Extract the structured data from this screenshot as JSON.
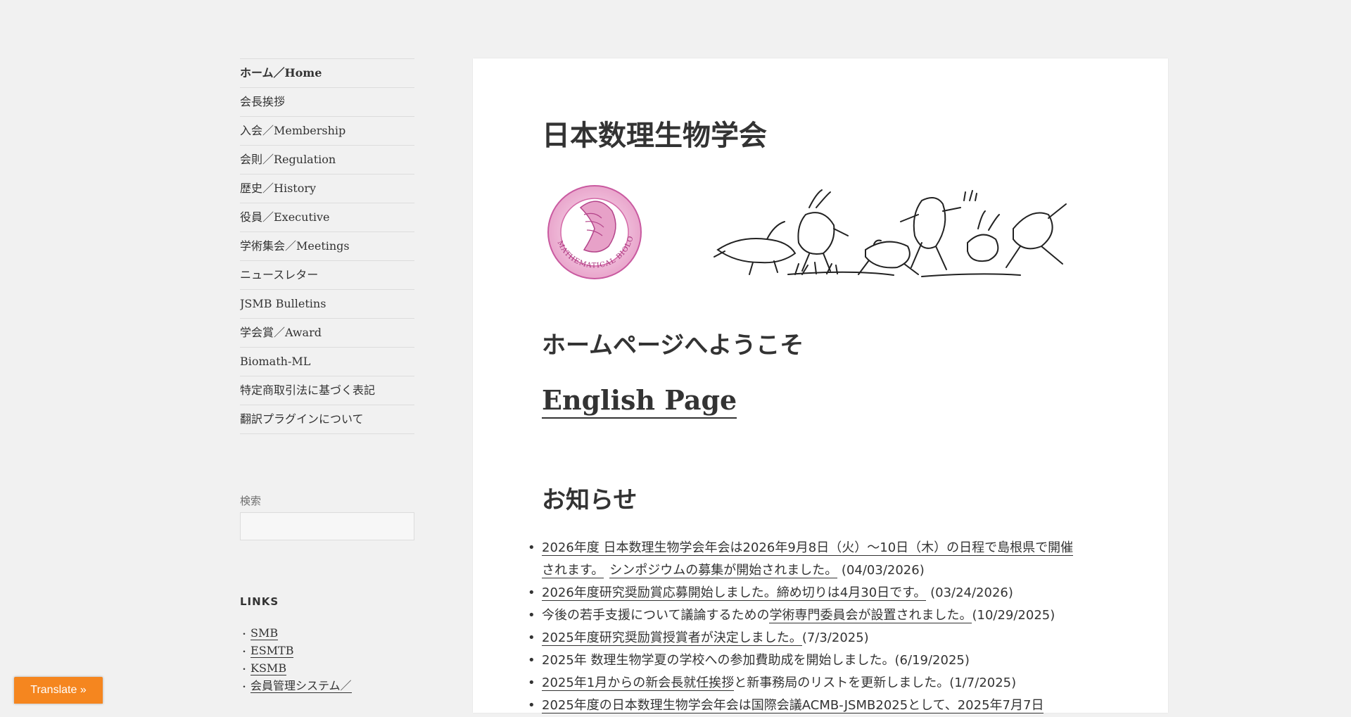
{
  "sidebar": {
    "nav": [
      {
        "label": "ホーム／Home"
      },
      {
        "label": "会長挨拶"
      },
      {
        "label": "入会／Membership"
      },
      {
        "label": "会則／Regulation"
      },
      {
        "label": "歴史／History"
      },
      {
        "label": "役員／Executive"
      },
      {
        "label": "学術集会／Meetings"
      },
      {
        "label": "ニュースレター"
      },
      {
        "label": "JSMB Bulletins"
      },
      {
        "label": "学会賞／Award"
      },
      {
        "label": "Biomath-ML"
      },
      {
        "label": "特定商取引法に基づく表記"
      },
      {
        "label": "翻訳プラグインについて"
      }
    ],
    "search": {
      "label": "検索",
      "value": "",
      "placeholder": ""
    },
    "links": {
      "title": "LINKS",
      "items": [
        {
          "label": "SMB"
        },
        {
          "label": "ESMTB"
        },
        {
          "label": "KSMB"
        },
        {
          "label": "会員管理システム／"
        }
      ]
    }
  },
  "main": {
    "site_title": "日本数理生物学会",
    "logo_text": "MATHEMATICAL BIOLOGY",
    "welcome": "ホームページへようこそ",
    "english_link": "English Page",
    "news_heading": "お知らせ",
    "news": [
      {
        "link": "2026年度 日本数理生物学会年会は2026年9月8日（火）〜10日（木）の日程で島根県で開催",
        "link2": "されます。",
        "mid": "",
        "link3": "シンポジウムの募集が開始されました。",
        "date": " (04/03/2026)"
      },
      {
        "link": "2026年度研究奨励賞応募開始しました。締め切りは4月30日です。",
        "date": " (03/24/2026)"
      },
      {
        "pre": "今後の若手支援について議論するための",
        "link": "学術専門委員会が設置されました。",
        "date": "(10/29/2025)"
      },
      {
        "link": "2025年度研究奨励賞授賞者が決定しました。",
        "date": "(7/3/2025)"
      },
      {
        "pre": "2025年 数理生物学夏の学校への参加費助成を開始しました。(6/19/2025)"
      },
      {
        "link": "2025年1月からの新会長就任挨拶",
        "mid": "と新事務局のリストを更新しました。(1/7/2025)"
      },
      {
        "link": "2025年度の日本数理生物学会年会は国際会議ACMB-JSMB2025として、2025年7月7日"
      }
    ]
  },
  "translate": {
    "label": "Translate »"
  },
  "colors": {
    "accent": "#f5861f",
    "background": "#f1f1f1",
    "card": "#ffffff",
    "text": "#333333",
    "logo_pink": "#d46aa8"
  }
}
